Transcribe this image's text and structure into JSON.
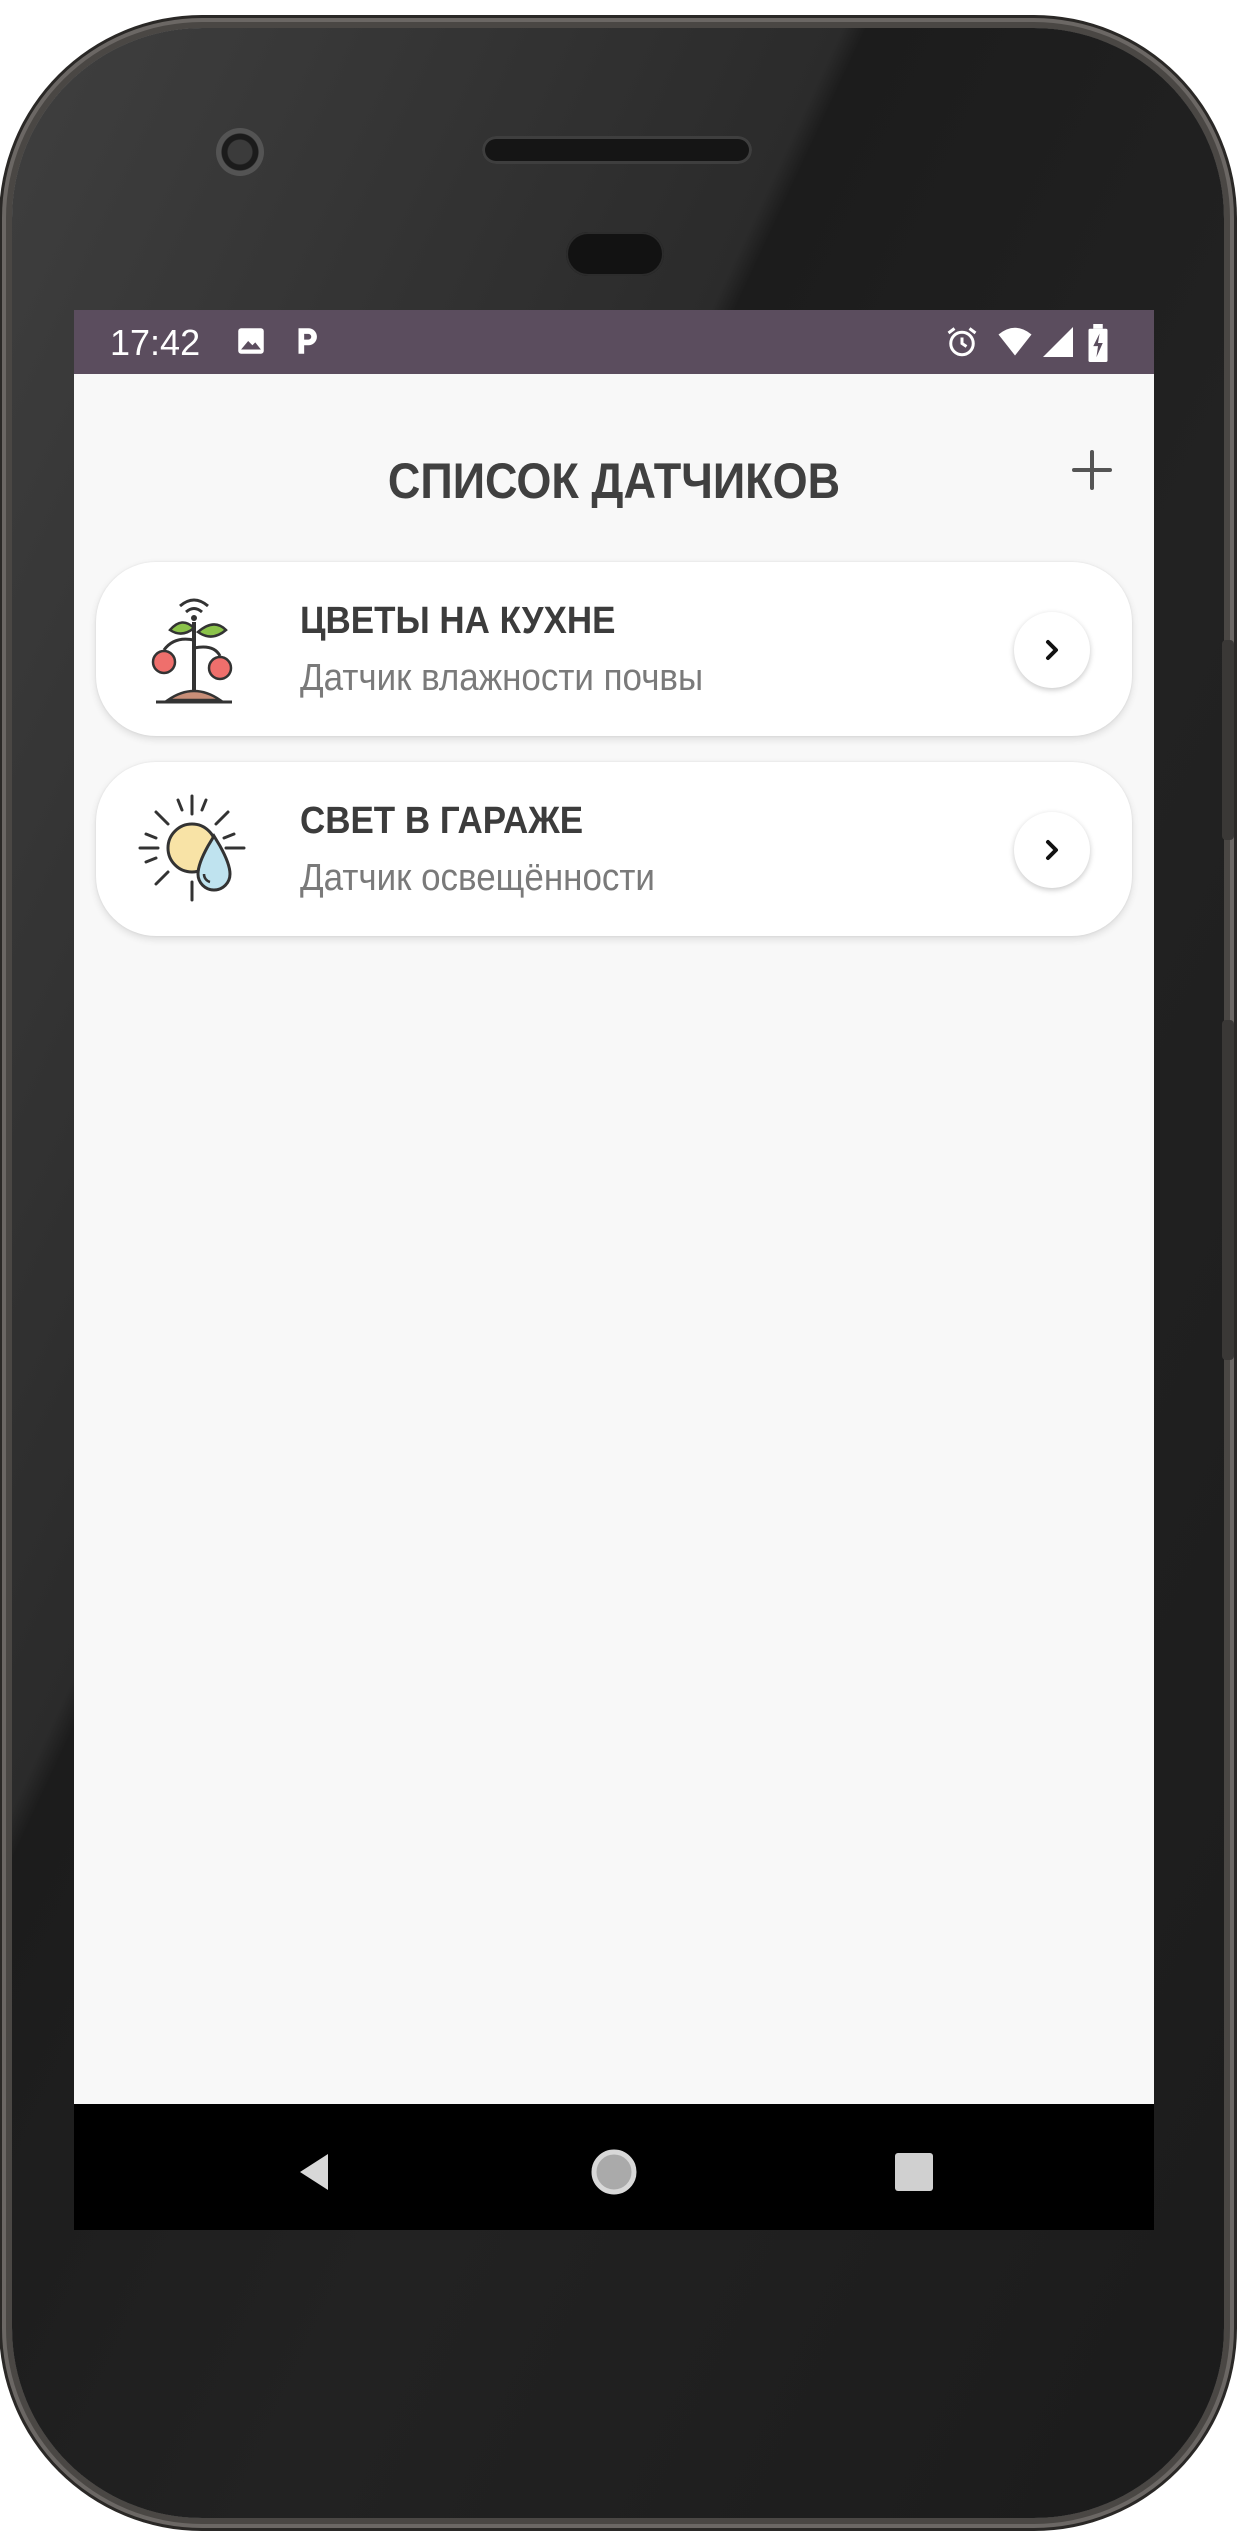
{
  "status_bar": {
    "time": "17:42",
    "left_icons": [
      "image-icon",
      "parking-icon"
    ],
    "right_icons": [
      "alarm-icon",
      "wifi-icon",
      "signal-icon",
      "battery-charging-icon"
    ],
    "color": "#5b4d5e"
  },
  "header": {
    "title": "СПИСОК ДАТЧИКОВ",
    "add_icon": "plus-icon"
  },
  "sensors": [
    {
      "name": "ЦВЕТЫ НА КУХНЕ",
      "type": "Датчик влажности почвы",
      "icon": "plant-sensor-icon"
    },
    {
      "name": "СВЕТ В ГАРАЖЕ",
      "type": "Датчик освещённости",
      "icon": "sun-drop-icon"
    }
  ],
  "nav_bar": {
    "buttons": [
      "back-icon",
      "home-icon",
      "recents-icon"
    ]
  },
  "colors": {
    "screen_bg": "#f8f8f8",
    "title_text": "#404040",
    "subtitle_text": "#7a7a7a"
  }
}
